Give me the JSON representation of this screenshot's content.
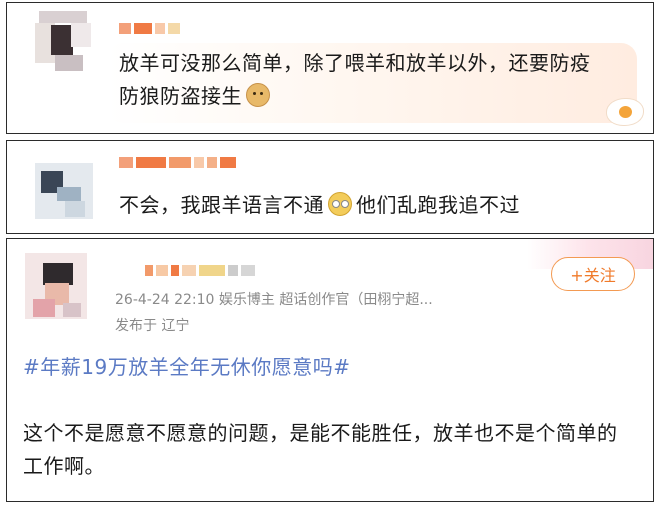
{
  "comments": [
    {
      "text_line1": "放羊可没那么简单，除了喂羊和放羊以外，还要防疫",
      "text_line2": "防狼防盗接生",
      "emoji": "doge-emoji"
    },
    {
      "text_before": "不会，我跟羊语言不通",
      "text_after": "他们乱跑我追不过",
      "emoji": "crying-emoji"
    }
  ],
  "post": {
    "meta_line": "26-4-24 22:10  娱乐博主 超话创作官（田栩宁超...",
    "location": "发布于 辽宁",
    "follow_label": "+关注",
    "topic": "#年薪19万放羊全年无休你愿意吗#",
    "body": "这个不是愿意不愿意的问题，是能不能胜任，放羊也不是个简单的工作啊。"
  },
  "colors": {
    "topic": "#5b7ac4",
    "follow": "#f07a2a",
    "meta": "#8a8a8a"
  }
}
